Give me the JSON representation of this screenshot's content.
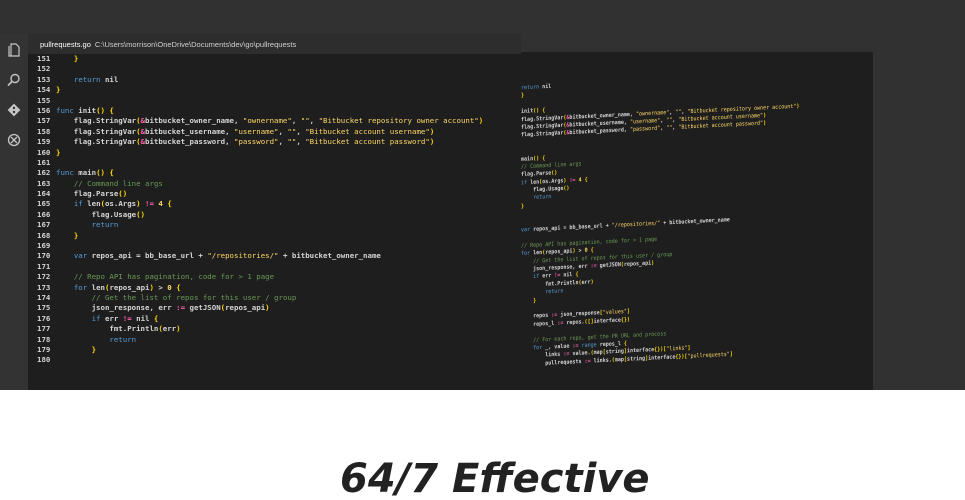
{
  "editor": {
    "file_name": "pullrequests.go",
    "file_path": "C:\\Users\\morrison\\OneDrive\\Documents\\dev\\go\\pullrequests",
    "lines": [
      {
        "n": "151",
        "t": "    }"
      },
      {
        "n": "152",
        "t": ""
      },
      {
        "n": "153",
        "t": "    return nil"
      },
      {
        "n": "154",
        "t": "}"
      },
      {
        "n": "155",
        "t": ""
      },
      {
        "n": "156",
        "t": "func init() {"
      },
      {
        "n": "157",
        "t": "    flag.StringVar(&bitbucket_owner_name, \"ownername\", \"\", \"Bitbucket repository owner account\")"
      },
      {
        "n": "158",
        "t": "    flag.StringVar(&bitbucket_username, \"username\", \"\", \"Bitbucket account username\")"
      },
      {
        "n": "159",
        "t": "    flag.StringVar(&bitbucket_password, \"password\", \"\", \"Bitbucket account password\")"
      },
      {
        "n": "160",
        "t": "}"
      },
      {
        "n": "161",
        "t": ""
      },
      {
        "n": "162",
        "t": "func main() {"
      },
      {
        "n": "163",
        "t": "    // Command line args"
      },
      {
        "n": "164",
        "t": "    flag.Parse()"
      },
      {
        "n": "165",
        "t": "    if len(os.Args) != 4 {"
      },
      {
        "n": "166",
        "t": "        flag.Usage()"
      },
      {
        "n": "167",
        "t": "        return"
      },
      {
        "n": "168",
        "t": "    }"
      },
      {
        "n": "169",
        "t": ""
      },
      {
        "n": "170",
        "t": "    var repos_api = bb_base_url + \"/repositories/\" + bitbucket_owner_name"
      },
      {
        "n": "171",
        "t": ""
      },
      {
        "n": "172",
        "t": "    // Repo API has pagination, code for > 1 page"
      },
      {
        "n": "173",
        "t": "    for len(repos_api) > 0 {"
      },
      {
        "n": "174",
        "t": "        // Get the list of repos for this user / group"
      },
      {
        "n": "175",
        "t": "        json_response, err := getJSON(repos_api)"
      },
      {
        "n": "176",
        "t": "        if err != nil {"
      },
      {
        "n": "177",
        "t": "            fmt.Println(err)"
      },
      {
        "n": "178",
        "t": "            return"
      },
      {
        "n": "179",
        "t": "        }"
      },
      {
        "n": "180",
        "t": ""
      }
    ]
  },
  "skewed": {
    "lines": [
      "return nil",
      "}",
      "",
      "init() {",
      "flag.StringVar(&bitbucket_owner_name, \"ownername\", \"\", \"Bitbucket repository owner account\")",
      "flag.StringVar(&bitbucket_username, \"username\", \"\", \"Bitbucket account username\")",
      "flag.StringVar(&bitbucket_password, \"password\", \"\", \"Bitbucket account password\")",
      "",
      "",
      "main() {",
      "// Command line args",
      "flag.Parse()",
      "if len(os.Args) != 4 {",
      "    flag.Usage()",
      "    return",
      "}",
      "",
      "",
      "var repos_api = bb_base_url + \"/repositories/\" + bitbucket_owner_name",
      "",
      "// Repo API has pagination, code for > 1 page",
      "for len(repos_api) > 0 {",
      "    // Get the list of repos for this user / group",
      "    json_response, err := getJSON(repos_api)",
      "    if err != nil {",
      "        fmt.Println(err)",
      "        return",
      "    }",
      "",
      "    repos := json_response[\"values\"]",
      "    repos_l := repos.([]interface{})",
      "",
      "    // For each repo, get the PR URL and process",
      "    for _, value := range repos_l {",
      "        links := value.(map[string]interface{})[\"links\"]",
      "        pullrequests := links.(map[string]interface{})[\"pullrequests\"]"
    ]
  },
  "caption": "64/7 Effective",
  "icons": [
    "files-icon",
    "search-icon",
    "source-control-icon",
    "extensions-icon"
  ]
}
